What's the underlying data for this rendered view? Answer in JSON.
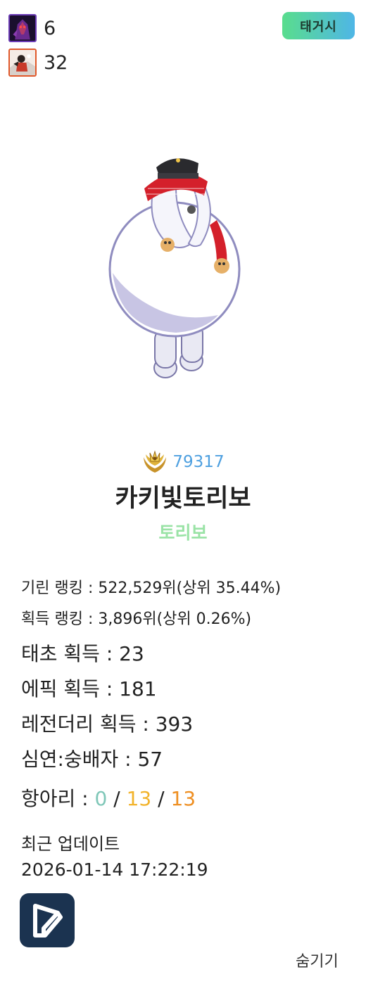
{
  "stats": [
    {
      "icon": "purple-monster-icon",
      "value": "6"
    },
    {
      "icon": "fighter-portrait-icon",
      "value": "32"
    }
  ],
  "tag_button": "태거시",
  "character": {
    "image": "snowman-character-with-red-scarf-and-cap"
  },
  "rank": {
    "icon": "gold-laurel-crown-icon",
    "number": "79317"
  },
  "name": "카키빛토리보",
  "subtitle": "토리보",
  "details": {
    "giraffe_ranking": "기린 랭킹 : 522,529위(상위 35.44%)",
    "acquire_ranking": "획득 랭킹 : 3,896위(상위 0.26%)",
    "first_acquire": "태초 획득 : 23",
    "epic_acquire": "에픽 획득 : 181",
    "legendary_acquire": "레전더리 획득 : 393",
    "abyss": "심연:숭배자 : 57",
    "jar_label": "항아리 : ",
    "jar_values": [
      "0",
      "13",
      "13"
    ],
    "jar_sep": " / "
  },
  "recent_update": {
    "label": "최근 업데이트",
    "datetime": "2026-01-14 17:22:19"
  },
  "app_logo": "d-logo-icon",
  "hide_button": "숨기기",
  "colors": {
    "accent_green": "#59dd8d",
    "accent_blue": "#4fb6e6",
    "rank_blue": "#4ea0e0",
    "subtitle_green": "#9ae3a6",
    "logo_bg": "#1b3350"
  }
}
